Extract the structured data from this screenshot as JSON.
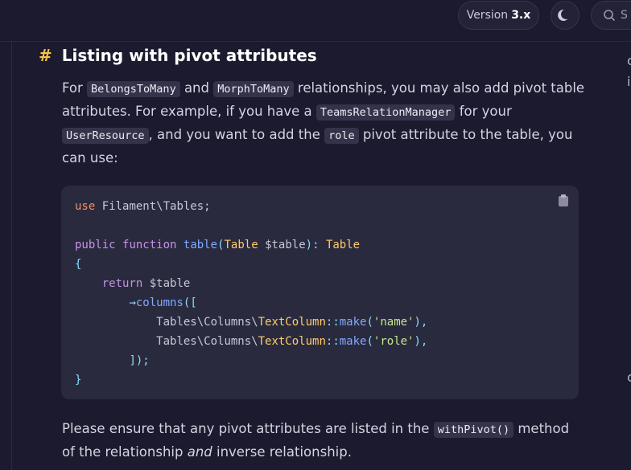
{
  "topbar": {
    "version_label": "Version",
    "version_value": "3.x",
    "search_placeholder": "S"
  },
  "section": {
    "hash": "#",
    "title": "Listing with pivot attributes"
  },
  "paragraph1": {
    "t1": "For ",
    "c1": "BelongsToMany",
    "t2": " and ",
    "c2": "MorphToMany",
    "t3": " relationships, you may also add pivot table attributes. For example, if you have a ",
    "c3": "TeamsRelationManager",
    "t4": " for your ",
    "c4": "UserResource",
    "t5": ", and you want to add the ",
    "c5": "role",
    "t6": " pivot attribute to the table, you can use:"
  },
  "code": {
    "l1_use": "use",
    "l1_ns": " Filament\\Tables;",
    "l3_public": "public",
    "l3_function": "function",
    "l3_name": "table",
    "l3_paren_open": "(",
    "l3_type": "Table",
    "l3_var": "$table",
    "l3_paren_close": "): ",
    "l3_ret": "Table",
    "l4": "{",
    "l5_return": "return",
    "l5_var": "$table",
    "l6_arrow": "→",
    "l6_method": "columns",
    "l6_open": "([",
    "l7_ns": "Tables\\Columns\\",
    "l7_class": "TextColumn",
    "l7_sep": "::",
    "l7_make": "make",
    "l7_open": "(",
    "l7_str": "'name'",
    "l7_close": "),",
    "l8_ns": "Tables\\Columns\\",
    "l8_class": "TextColumn",
    "l8_sep": "::",
    "l8_make": "make",
    "l8_open": "(",
    "l8_str": "'role'",
    "l8_close": "),",
    "l9": "]);",
    "l10": "}"
  },
  "paragraph2": {
    "t1": "Please ensure that any pivot attributes are listed in the ",
    "c1": "withPivot()",
    "t2": " method of the relationship ",
    "em": "and",
    "t3": " inverse relationship."
  },
  "side": {
    "g1": "c",
    "g2": "i",
    "g3": "c"
  },
  "colors": {
    "background": "#1b1a2e",
    "code_background": "#2a2a3e",
    "hash_accent": "#f6c343"
  }
}
